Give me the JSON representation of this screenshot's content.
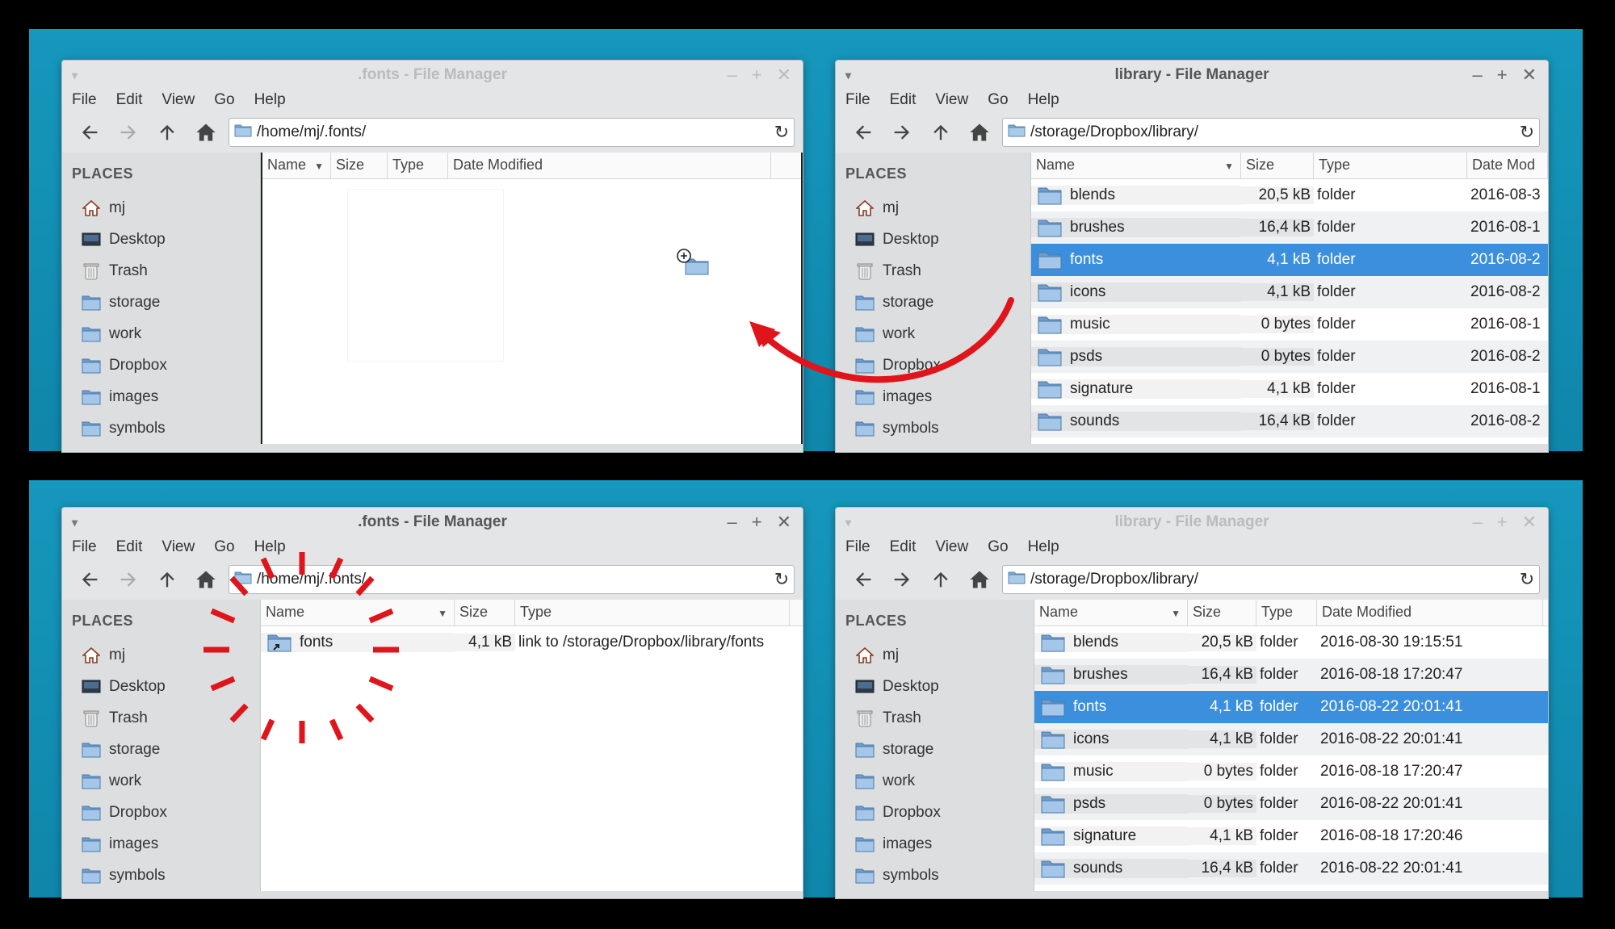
{
  "windows": {
    "top_left": {
      "title": ".fonts - File Manager",
      "active": false,
      "menu": [
        "File",
        "Edit",
        "View",
        "Go",
        "Help"
      ],
      "location": "/home/mj/.fonts/",
      "columns": [
        "Name",
        "Size",
        "Type",
        "Date Modified"
      ],
      "rows": []
    },
    "top_right": {
      "title": "library - File Manager",
      "active": true,
      "menu": [
        "File",
        "Edit",
        "View",
        "Go",
        "Help"
      ],
      "location": "/storage/Dropbox/library/",
      "columns": [
        "Name",
        "Size",
        "Type",
        "Date Mod"
      ],
      "rows": [
        {
          "name": "blends",
          "size": "20,5 kB",
          "type": "folder",
          "date": "2016-08-3",
          "selected": false
        },
        {
          "name": "brushes",
          "size": "16,4 kB",
          "type": "folder",
          "date": "2016-08-1",
          "selected": false
        },
        {
          "name": "fonts",
          "size": "4,1 kB",
          "type": "folder",
          "date": "2016-08-2",
          "selected": true
        },
        {
          "name": "icons",
          "size": "4,1 kB",
          "type": "folder",
          "date": "2016-08-2",
          "selected": false
        },
        {
          "name": "music",
          "size": "0 bytes",
          "type": "folder",
          "date": "2016-08-1",
          "selected": false
        },
        {
          "name": "psds",
          "size": "0 bytes",
          "type": "folder",
          "date": "2016-08-2",
          "selected": false
        },
        {
          "name": "signature",
          "size": "4,1 kB",
          "type": "folder",
          "date": "2016-08-1",
          "selected": false
        },
        {
          "name": "sounds",
          "size": "16,4 kB",
          "type": "folder",
          "date": "2016-08-2",
          "selected": false
        }
      ]
    },
    "bottom_left": {
      "title": ".fonts - File Manager",
      "active": true,
      "menu": [
        "File",
        "Edit",
        "View",
        "Go",
        "Help"
      ],
      "location": "/home/mj/.fonts/",
      "columns": [
        "Name",
        "Size",
        "Type"
      ],
      "rows": [
        {
          "name": "fonts",
          "size": "4,1 kB",
          "type": "link to /storage/Dropbox/library/fonts",
          "selected": false
        }
      ]
    },
    "bottom_right": {
      "title": "library - File Manager",
      "active": false,
      "menu": [
        "File",
        "Edit",
        "View",
        "Go",
        "Help"
      ],
      "location": "/storage/Dropbox/library/",
      "columns": [
        "Name",
        "Size",
        "Type",
        "Date Modified"
      ],
      "rows": [
        {
          "name": "blends",
          "size": "20,5 kB",
          "type": "folder",
          "date": "2016-08-30 19:15:51",
          "selected": false
        },
        {
          "name": "brushes",
          "size": "16,4 kB",
          "type": "folder",
          "date": "2016-08-18 17:20:47",
          "selected": false
        },
        {
          "name": "fonts",
          "size": "4,1 kB",
          "type": "folder",
          "date": "2016-08-22 20:01:41",
          "selected": true
        },
        {
          "name": "icons",
          "size": "4,1 kB",
          "type": "folder",
          "date": "2016-08-22 20:01:41",
          "selected": false
        },
        {
          "name": "music",
          "size": "0 bytes",
          "type": "folder",
          "date": "2016-08-18 17:20:47",
          "selected": false
        },
        {
          "name": "psds",
          "size": "0 bytes",
          "type": "folder",
          "date": "2016-08-22 20:01:41",
          "selected": false
        },
        {
          "name": "signature",
          "size": "4,1 kB",
          "type": "folder",
          "date": "2016-08-18 17:20:46",
          "selected": false
        },
        {
          "name": "sounds",
          "size": "16,4 kB",
          "type": "folder",
          "date": "2016-08-22 20:01:41",
          "selected": false
        }
      ]
    }
  },
  "places": {
    "heading": "PLACES",
    "items": [
      {
        "label": "mj",
        "icon": "home-icon"
      },
      {
        "label": "Desktop",
        "icon": "desktop-icon"
      },
      {
        "label": "Trash",
        "icon": "trash-icon"
      },
      {
        "label": "storage",
        "icon": "folder-icon"
      },
      {
        "label": "work",
        "icon": "folder-icon"
      },
      {
        "label": "Dropbox",
        "icon": "folder-icon"
      },
      {
        "label": "images",
        "icon": "folder-icon"
      },
      {
        "label": "symbols",
        "icon": "folder-icon"
      }
    ]
  },
  "colors": {
    "desktop": "#1697bd",
    "selection": "#3c8fdc",
    "annotation": "#e0141b"
  }
}
